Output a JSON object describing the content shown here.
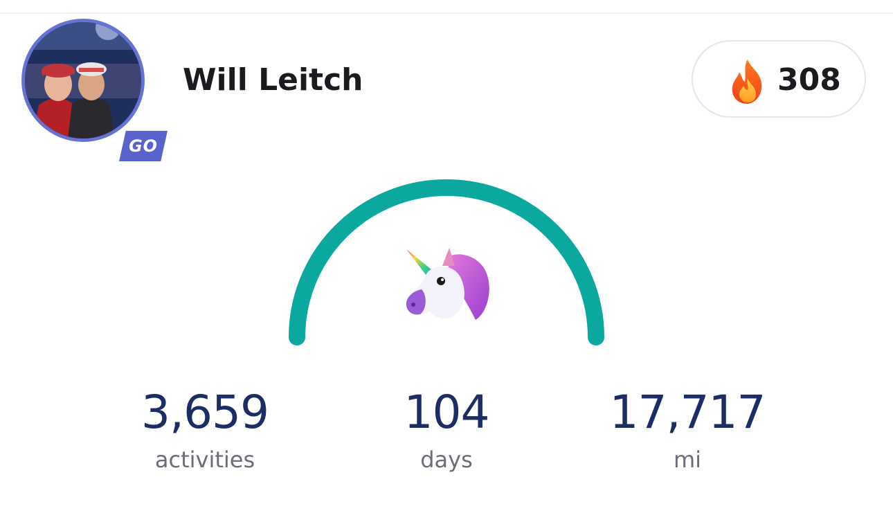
{
  "profile": {
    "name": "Will Leitch",
    "badge": "GO",
    "avatar_icon": "user-photo"
  },
  "streak": {
    "icon": "fire-icon",
    "count": "308"
  },
  "gauge": {
    "icon": "unicorn-icon",
    "color": "#0aa89e"
  },
  "stats": [
    {
      "value": "3,659",
      "label": "activities"
    },
    {
      "value": "104",
      "label": "days"
    },
    {
      "value": "17,717",
      "label": "mi"
    }
  ],
  "colors": {
    "accent": "#6672d6",
    "stat_value": "#1c2d66",
    "stat_label": "#6b6d7a"
  }
}
